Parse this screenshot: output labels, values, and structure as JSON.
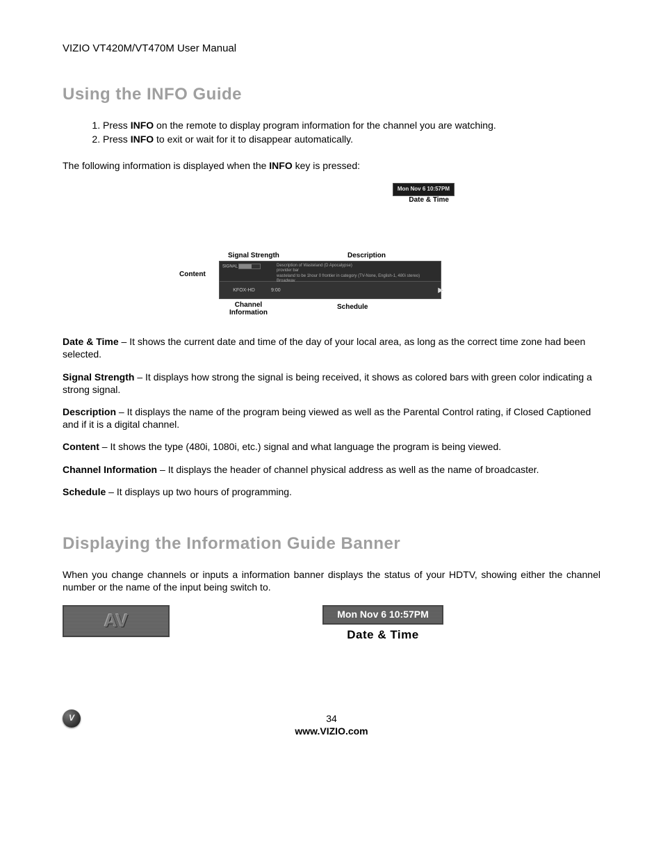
{
  "header": "VIZIO VT420M/VT470M User Manual",
  "h1a": "Using the INFO Guide",
  "steps": [
    {
      "pre": "Press ",
      "bold": "INFO",
      "post": " on the remote to display program information for the channel you are watching."
    },
    {
      "pre": "Press ",
      "bold": "INFO",
      "post": " to exit or wait for it to disappear automatically."
    }
  ],
  "intro": {
    "pre": "The following information is displayed when the ",
    "bold": "INFO",
    "post": " key is pressed:"
  },
  "diagram": {
    "dt_pill": "Mon Nov 6 10:57PM",
    "dt_cap": "Date & Time",
    "lbl_ss": "Signal Strength",
    "lbl_desc": "Description",
    "lbl_content": "Content",
    "sig_label": "SIGNAL",
    "sig_bars": "▮▮▮▮▯▯",
    "desc_line1": "Description of Wasteland (D Apocalypse)",
    "desc_line2": "provider bar",
    "desc_line3": "wasteland to be 1hour 0 frontier in category (TV-None, English-1, 480i stereo)",
    "desc_line4": "Broadway",
    "time": "9:00",
    "channel": "KFOX-HD",
    "lbl_chinfo_l1": "Channel",
    "lbl_chinfo_l2": "Information",
    "lbl_sched": "Schedule"
  },
  "defs": [
    {
      "term": "Date & Time",
      "text": " – It shows the current date and time of the day of your local area, as long as the correct time zone had been selected."
    },
    {
      "term": "Signal Strength",
      "text": " – It displays how strong the signal is being received, it shows as colored bars with green color indicating a strong signal."
    },
    {
      "term": "Description",
      "text": " – It displays the name of the program being viewed as well as the Parental Control rating, if Closed Captioned and if it is a digital channel."
    },
    {
      "term": "Content",
      "text": " – It shows the type (480i, 1080i, etc.) signal and what language the program is being viewed."
    },
    {
      "term": "Channel Information",
      "text": " – It displays the header of channel physical address as well as the name of broadcaster."
    },
    {
      "term": "Schedule",
      "text": " – It displays up two hours of programming."
    }
  ],
  "h1b": "Displaying the Information Guide Banner",
  "para2": "When you change channels or inputs a information banner displays the status of your HDTV, showing either the channel number or the name of the input being switch to.",
  "av": "AV",
  "dt_banner": "Mon Nov 6 10:57PM",
  "dt_label": "Date & Time",
  "footer": {
    "page": "34",
    "url": "www.VIZIO.com",
    "logo": "V"
  }
}
